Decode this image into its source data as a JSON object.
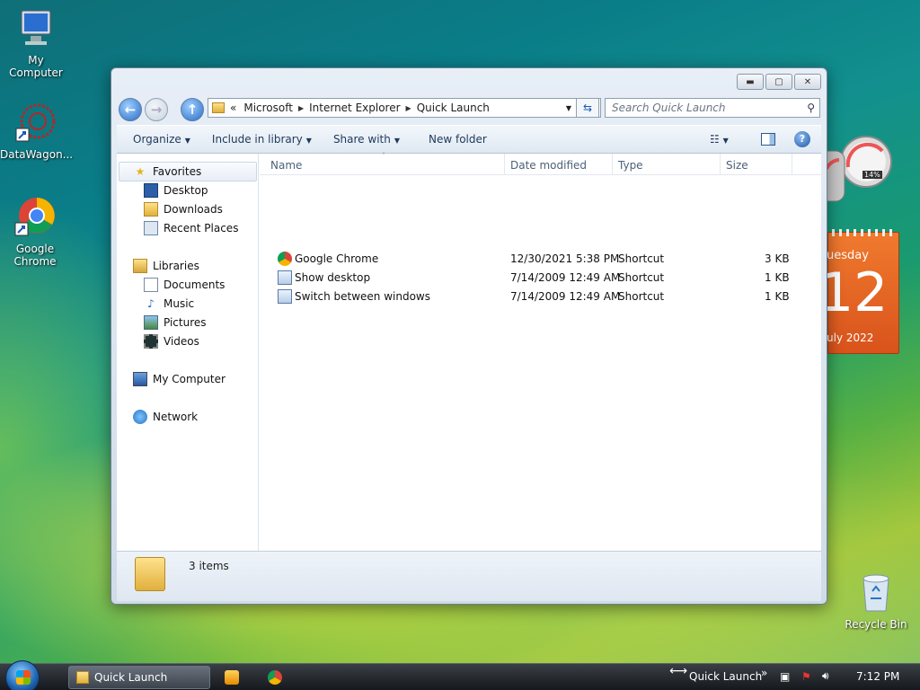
{
  "desktop": {
    "icons": [
      {
        "label": "My Computer",
        "icon": "computer-icon"
      },
      {
        "label": "DataWagon...",
        "icon": "datawagon-icon"
      },
      {
        "label": "Google Chrome",
        "icon": "chrome-icon"
      },
      {
        "label": "Recycle Bin",
        "icon": "recycle-bin-icon"
      }
    ],
    "calendar": {
      "day_name": "uesday",
      "day": "12",
      "month_year": "uly 2022"
    },
    "gauge": {
      "label": "14%"
    }
  },
  "window": {
    "address": {
      "overflow": "«",
      "crumbs": [
        "Microsoft",
        "Internet Explorer",
        "Quick Launch"
      ]
    },
    "search_placeholder": "Search Quick Launch",
    "toolbar": {
      "organize": "Organize",
      "include": "Include in library",
      "share": "Share with",
      "new_folder": "New folder"
    },
    "nav": {
      "favorites": "Favorites",
      "desktop": "Desktop",
      "downloads": "Downloads",
      "recent": "Recent Places",
      "libraries": "Libraries",
      "documents": "Documents",
      "music": "Music",
      "pictures": "Pictures",
      "videos": "Videos",
      "computer": "My Computer",
      "network": "Network"
    },
    "columns": [
      "Name",
      "Date modified",
      "Type",
      "Size"
    ],
    "files": [
      {
        "name": "Google Chrome",
        "date": "12/30/2021 5:38 PM",
        "type": "Shortcut",
        "size": "3 KB"
      },
      {
        "name": "Show desktop",
        "date": "7/14/2009 12:49 AM",
        "type": "Shortcut",
        "size": "1 KB"
      },
      {
        "name": "Switch between windows",
        "date": "7/14/2009 12:49 AM",
        "type": "Shortcut",
        "size": "1 KB"
      }
    ],
    "status": "3 items"
  },
  "taskbar": {
    "task_label": "Quick Launch",
    "toolbar_label": "Quick Launch",
    "clock": "7:12 PM"
  },
  "colors": {
    "accent": "#1e395b",
    "calendar": "#e8621e"
  }
}
